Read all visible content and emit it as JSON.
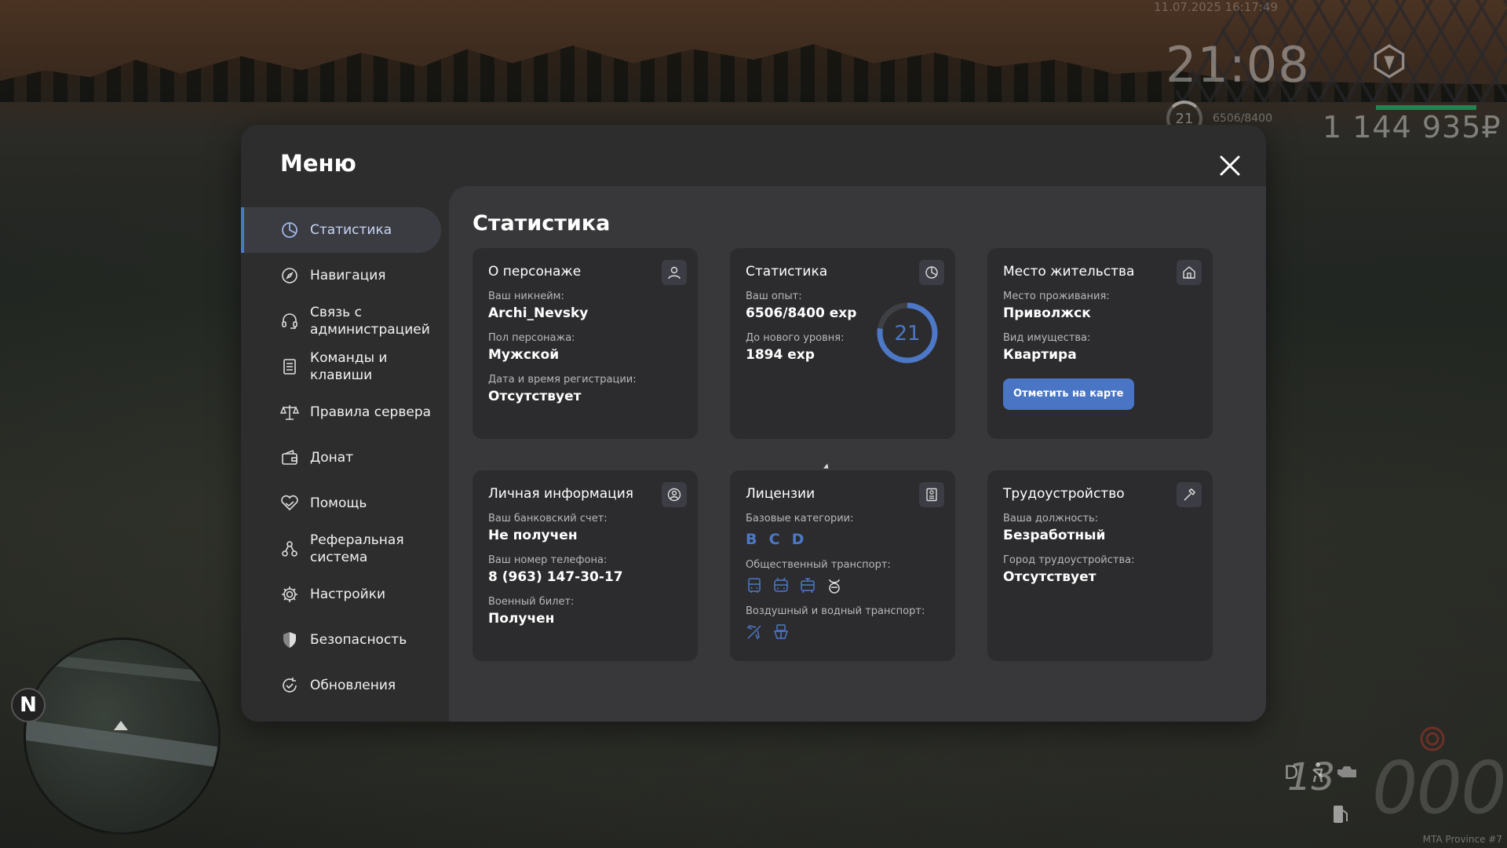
{
  "hud": {
    "date": "11.07.2025 16:17:49",
    "time": "21:08",
    "level": "21",
    "exp": "6506/8400",
    "money": "1 144 935₽",
    "gear": "D",
    "speed_digits": "13",
    "speed_zeros": "000",
    "compass": "N",
    "watermark": "MTA Province #7"
  },
  "menu": {
    "title": "Меню",
    "close_icon": "close-icon"
  },
  "sidebar": {
    "items": [
      {
        "label": "Статистика",
        "icon": "pie-chart-icon",
        "active": true
      },
      {
        "label": "Навигация",
        "icon": "compass-icon"
      },
      {
        "label": "Связь с администрацией",
        "icon": "headset-icon"
      },
      {
        "label": "Команды и клавиши",
        "icon": "keyboard-list-icon"
      },
      {
        "label": "Правила сервера",
        "icon": "scales-icon"
      },
      {
        "label": "Донат",
        "icon": "wallet-icon"
      },
      {
        "label": "Помощь",
        "icon": "handshake-heart-icon"
      },
      {
        "label": "Реферальная система",
        "icon": "referral-icon"
      },
      {
        "label": "Настройки",
        "icon": "gear-icon"
      },
      {
        "label": "Безопасность",
        "icon": "shield-icon"
      },
      {
        "label": "Обновления",
        "icon": "refresh-check-icon"
      }
    ]
  },
  "content": {
    "title": "Статистика",
    "character": {
      "title": "О персонаже",
      "nickname_label": "Ваш никнейм:",
      "nickname": "Archi_Nevsky",
      "gender_label": "Пол персонажа:",
      "gender": "Мужской",
      "reg_label": "Дата и время регистрации:",
      "reg": "Отсутствует"
    },
    "stats": {
      "title": "Статистика",
      "exp_label": "Ваш опыт:",
      "exp": "6506/8400 exp",
      "next_label": "До нового уровня:",
      "next": "1894 exp",
      "level": "21",
      "level_progress": 0.7745
    },
    "residence": {
      "title": "Место жительства",
      "place_label": "Место проживания:",
      "place": "Приволжск",
      "property_label": "Вид имущества:",
      "property": "Квартира",
      "button": "Отметить на карте"
    },
    "personal": {
      "title": "Личная информация",
      "bank_label": "Ваш банковский счет:",
      "bank": "Не получен",
      "phone_label": "Ваш номер телефона:",
      "phone": "8 (963) 147-30-17",
      "military_label": "Военный билет:",
      "military": "Получен"
    },
    "licenses": {
      "title": "Лицензии",
      "base_label": "Базовые категории:",
      "base_cats": [
        "B",
        "C",
        "D"
      ],
      "public_label": "Общественный транспорт:",
      "public_icons": [
        "bus-icon",
        "trolleybus-icon",
        "tram-icon",
        "taxi-icon"
      ],
      "air_label": "Воздушный и водный транспорт:",
      "air_icons": [
        "plane-icon",
        "boat-icon"
      ]
    },
    "job": {
      "title": "Трудоустройство",
      "position_label": "Ваша должность:",
      "position": "Безработный",
      "city_label": "Город трудоустройства:",
      "city": "Отсутствует"
    }
  },
  "colors": {
    "accent": "#4c78c7",
    "modal_bg": "#2d2d2e",
    "content_bg": "#38383b",
    "card_bg": "#2c2c2e"
  }
}
